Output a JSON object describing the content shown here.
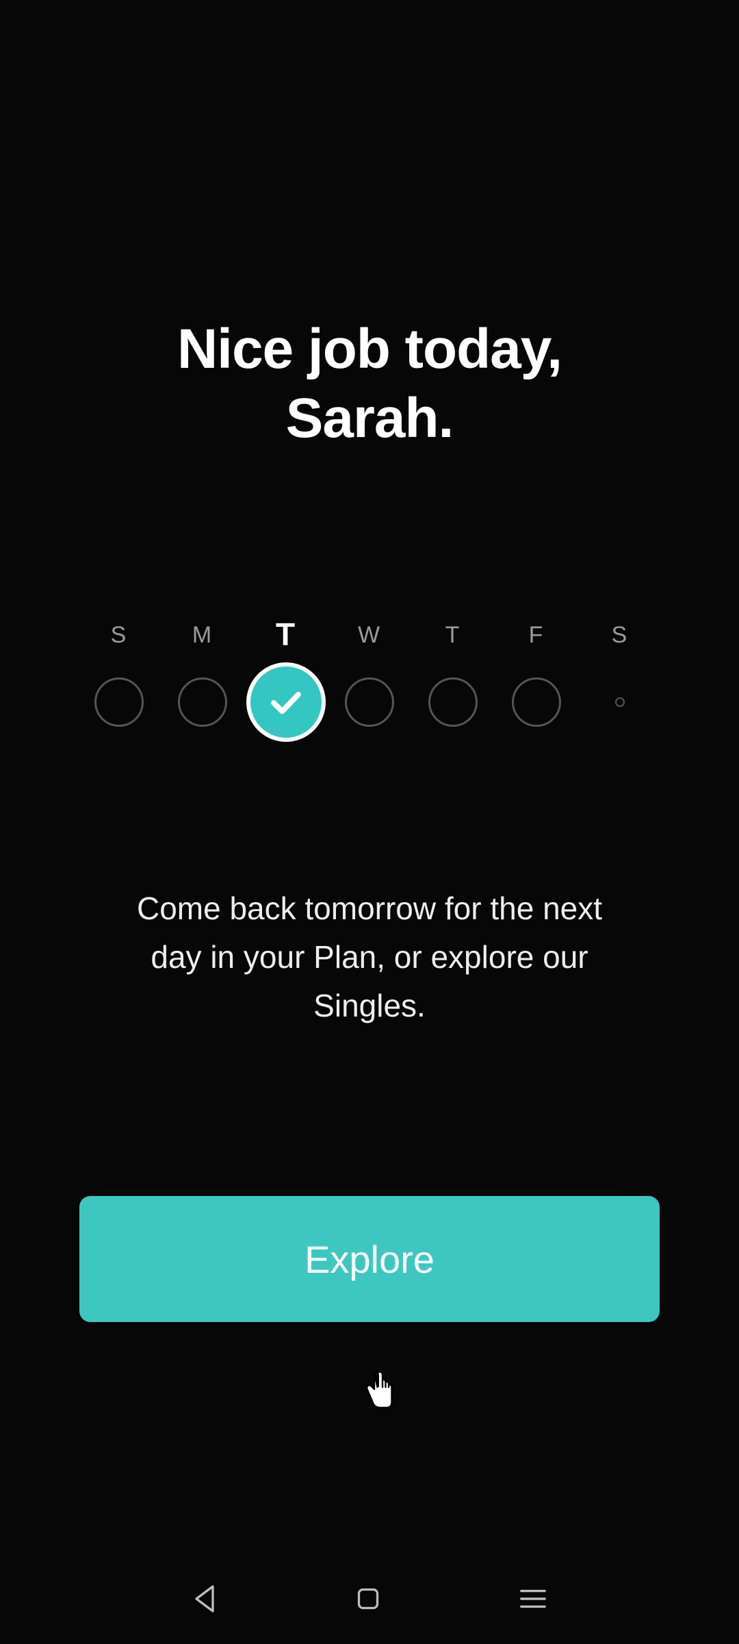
{
  "title_line1": "Nice job today,",
  "title_line2": "Sarah.",
  "week": {
    "days": [
      {
        "label": "S",
        "state": "empty"
      },
      {
        "label": "M",
        "state": "empty"
      },
      {
        "label": "T",
        "state": "active"
      },
      {
        "label": "W",
        "state": "empty"
      },
      {
        "label": "T",
        "state": "empty"
      },
      {
        "label": "F",
        "state": "empty"
      },
      {
        "label": "S",
        "state": "tiny"
      }
    ]
  },
  "body_text": "Come back tomorrow for the next day in your Plan, or explore our Singles.",
  "cta_label": "Explore",
  "colors": {
    "accent": "#3ec7c0",
    "bg": "#070707"
  }
}
